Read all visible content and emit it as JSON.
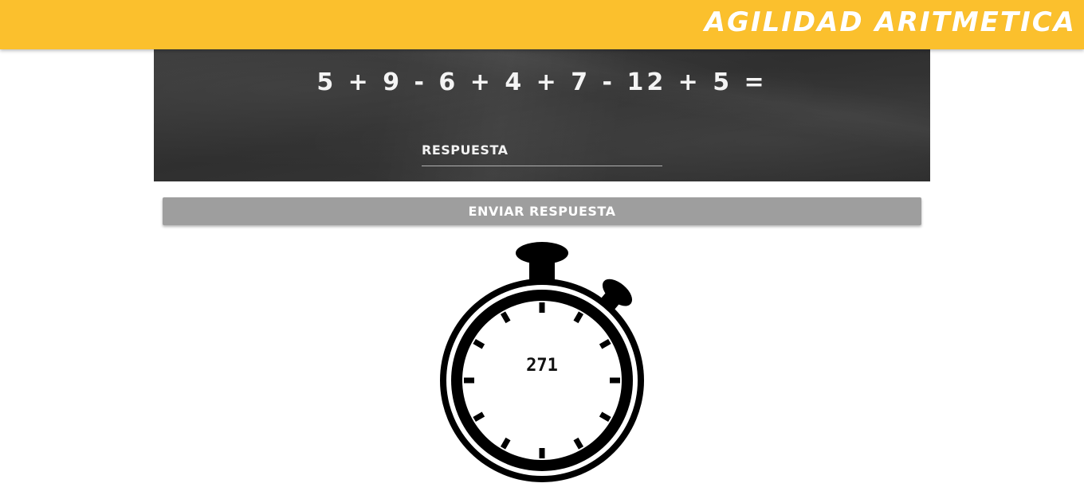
{
  "header": {
    "title": "AGILIDAD ARITMETICA",
    "background_color": "#FBC02D"
  },
  "question": {
    "equation": "5 + 9 - 6 + 4 + 7 - 12 + 5 ="
  },
  "answer_input": {
    "placeholder": "RESPUESTA",
    "value": ""
  },
  "submit": {
    "label": "ENVIAR RESPUESTA",
    "color": "#9E9E9E"
  },
  "timer": {
    "icon": "stopwatch-icon",
    "value": "271"
  }
}
